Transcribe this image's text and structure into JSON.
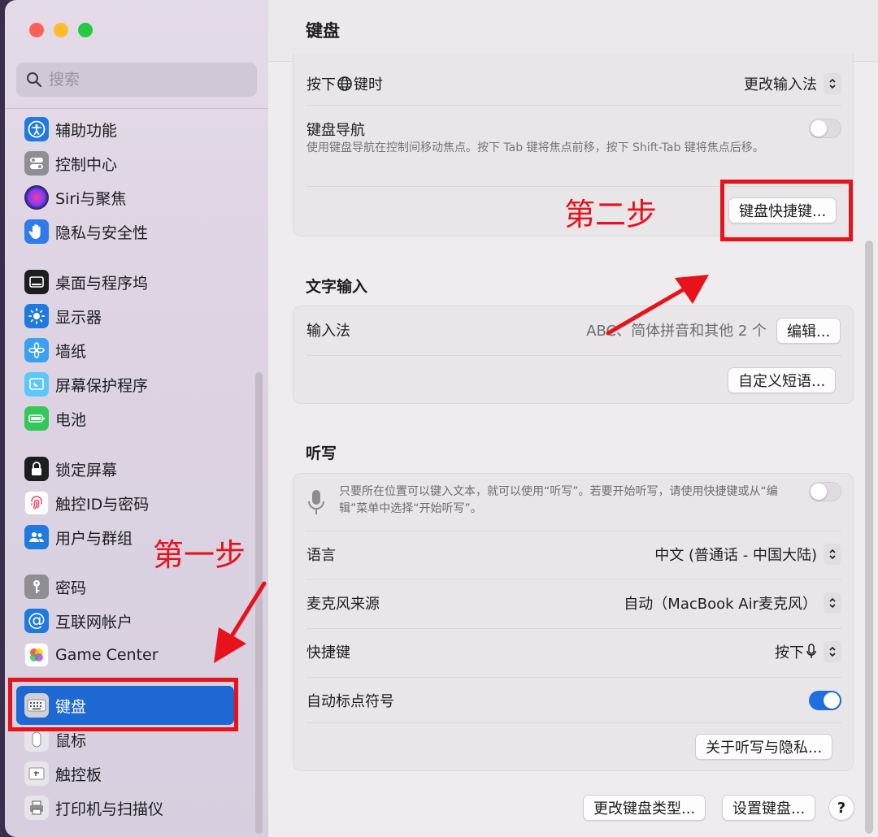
{
  "sidebar": {
    "search_placeholder": "搜索",
    "items": [
      {
        "label": "辅助功能",
        "icon": "accessibility-icon"
      },
      {
        "label": "控制中心",
        "icon": "control-center-icon"
      },
      {
        "label": "Siri与聚焦",
        "icon": "siri-icon"
      },
      {
        "label": "隐私与安全性",
        "icon": "hand-icon"
      },
      {
        "label": "桌面与程序坞",
        "icon": "dock-icon"
      },
      {
        "label": "显示器",
        "icon": "sun-icon"
      },
      {
        "label": "墙纸",
        "icon": "flower-icon"
      },
      {
        "label": "屏幕保护程序",
        "icon": "screensaver-icon"
      },
      {
        "label": "电池",
        "icon": "battery-icon"
      },
      {
        "label": "锁定屏幕",
        "icon": "lock-icon"
      },
      {
        "label": "触控ID与密码",
        "icon": "fingerprint-icon"
      },
      {
        "label": "用户与群组",
        "icon": "users-icon"
      },
      {
        "label": "密码",
        "icon": "key-icon"
      },
      {
        "label": "互联网帐户",
        "icon": "at-icon"
      },
      {
        "label": "Game Center",
        "icon": "game-center-icon"
      },
      {
        "label": "键盘",
        "icon": "keyboard-icon",
        "active": true
      },
      {
        "label": "鼠标",
        "icon": "mouse-icon"
      },
      {
        "label": "触控板",
        "icon": "trackpad-icon"
      },
      {
        "label": "打印机与扫描仪",
        "icon": "printer-icon"
      }
    ]
  },
  "main": {
    "title": "键盘",
    "keyboard_card": {
      "globe_row_label_pre": "按下",
      "globe_row_label_post": "键时",
      "globe_row_value": "更改输入法",
      "nav_label": "键盘导航",
      "nav_desc": "使用键盘导航在控制间移动焦点。按下 Tab 键将焦点前移，按下 Shift-Tab 键将焦点后移。",
      "nav_toggle": false,
      "shortcuts_button": "键盘快捷键..."
    },
    "text_input": {
      "section_title": "文字输入",
      "input_method_label": "输入法",
      "input_method_value": "ABC、简体拼音和其他 2 个",
      "edit_button": "编辑...",
      "custom_phrases_button": "自定义短语..."
    },
    "dictation": {
      "section_title": "听写",
      "desc": "只要所在位置可以键入文本，就可以使用“听写”。若要开始听写，请使用快捷键或从“编辑”菜单中选择“开始听写”。",
      "toggle": false,
      "language_label": "语言",
      "language_value": "中文 (普通话 - 中国大陆)",
      "mic_label": "麦克风来源",
      "mic_value": "自动（MacBook Air麦克风）",
      "shortcut_label": "快捷键",
      "shortcut_value": "按下",
      "auto_punct_label": "自动标点符号",
      "auto_punct_toggle": true,
      "privacy_button": "关于听写与隐私..."
    },
    "footer": {
      "change_type_button": "更改键盘类型...",
      "setup_button": "设置键盘...",
      "help_button": "?"
    }
  },
  "annotations": {
    "step1": "第一步",
    "step2": "第二步",
    "color": "#e8121a"
  }
}
